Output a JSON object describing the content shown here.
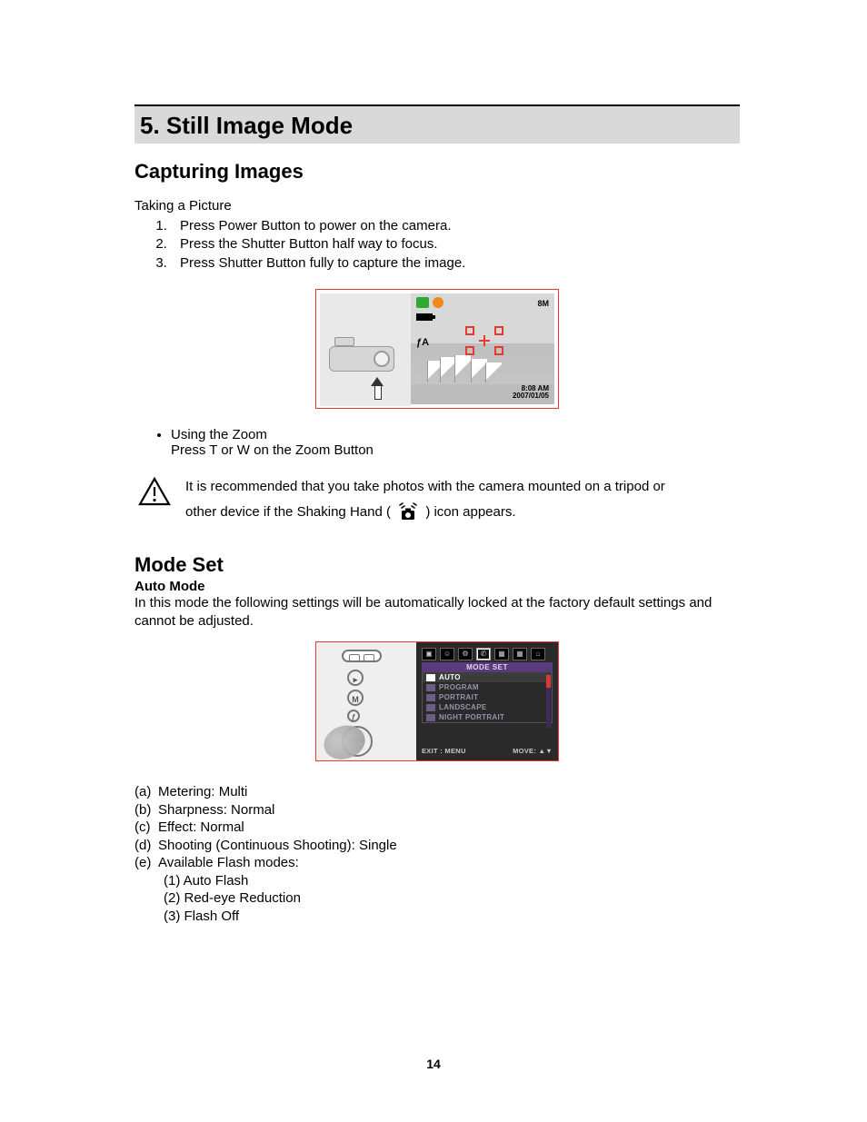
{
  "headings": {
    "h1": "5. Still Image Mode",
    "h2_capturing": "Capturing Images",
    "h2_modeset": "Mode Set",
    "h3_automode": "Auto Mode"
  },
  "taking_picture": {
    "intro": "Taking a Picture",
    "steps": [
      "Press Power Button to power on the camera.",
      "Press the Shutter Button half way to focus.",
      "Press Shutter Button fully to capture the image."
    ]
  },
  "fig1_osd": {
    "flash": "ƒA",
    "res": "8M",
    "time": "8:08 AM",
    "date": "2007/01/05"
  },
  "zoom": {
    "title": "Using the Zoom",
    "body": "Press T or W on the Zoom Button"
  },
  "warning": {
    "line_a": "It is recommended that you take photos with the camera mounted on a tripod or",
    "line_b_pre": "other device if the Shaking Hand (",
    "line_b_post": ") icon appears."
  },
  "automode_desc": "In this mode the following settings will be automatically locked at the factory default settings and cannot be adjusted.",
  "mode_menu": {
    "title": "MODE SET",
    "items": [
      "AUTO",
      "PROGRAM",
      "PORTRAIT",
      "LANDSCAPE",
      "NIGHT PORTRAIT"
    ],
    "footer_left": "EXIT : MENU",
    "footer_right": "MOVE: ▲▼"
  },
  "settings_list": [
    {
      "label": "(a)",
      "text": "Metering: Multi"
    },
    {
      "label": "(b)",
      "text": "Sharpness: Normal"
    },
    {
      "label": "(c)",
      "text": "Effect: Normal"
    },
    {
      "label": "(d)",
      "text": "Shooting (Continuous Shooting): Single"
    },
    {
      "label": "(e)",
      "text": "Available Flash modes:"
    }
  ],
  "flash_modes": [
    "(1) Auto Flash",
    "(2) Red-eye Reduction",
    "(3) Flash Off"
  ],
  "page_number": "14"
}
